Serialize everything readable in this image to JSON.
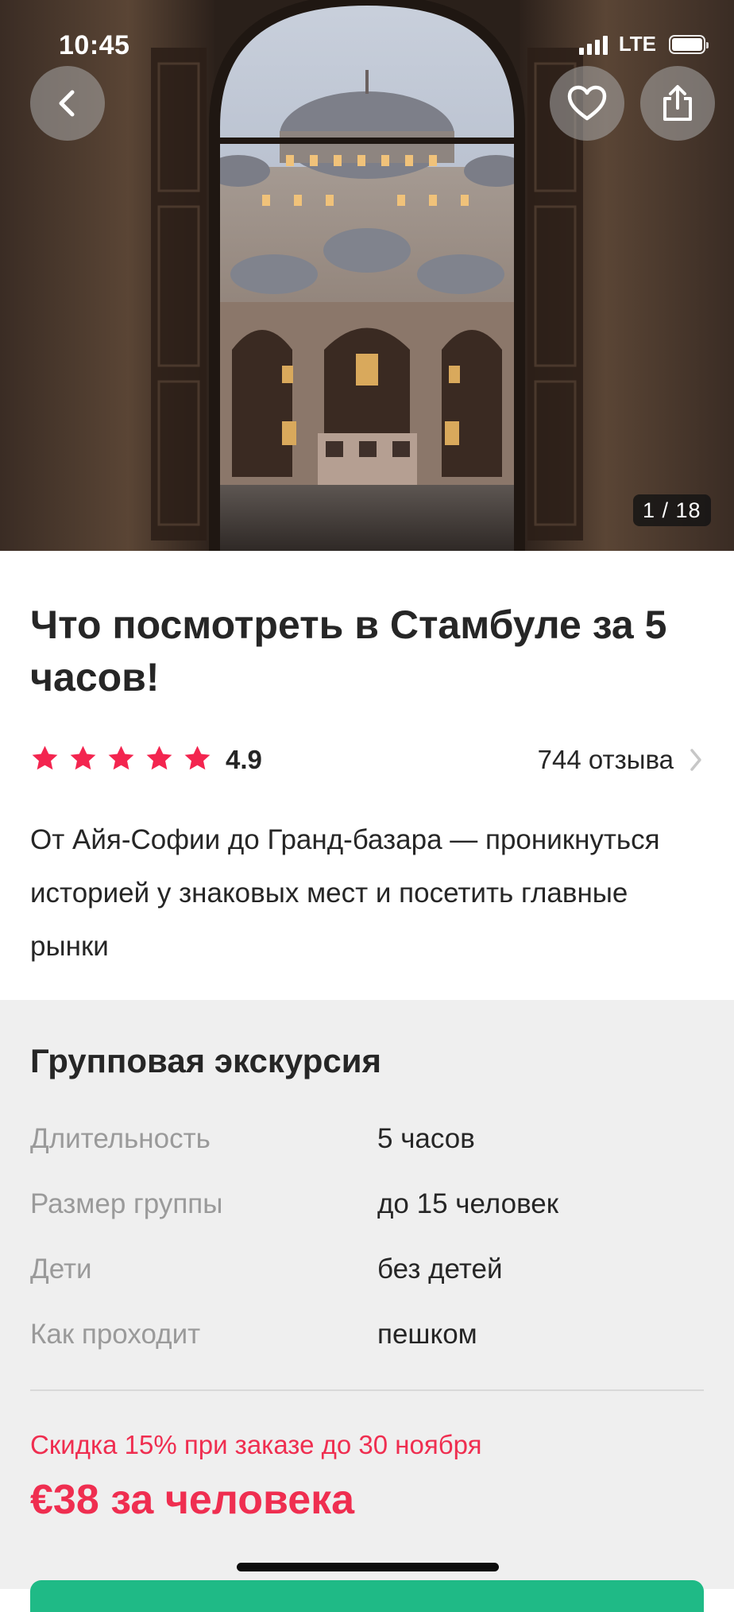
{
  "status_bar": {
    "time": "10:45",
    "network": "LTE"
  },
  "hero": {
    "back_icon": "chevron-left-icon",
    "favorite_icon": "heart-outline-icon",
    "share_icon": "share-icon",
    "photo_counter": "1 / 18"
  },
  "tour": {
    "title": "Что посмотреть в Стамбуле за 5 часов!",
    "rating": "4.9",
    "stars": 5,
    "reviews": "744 отзыва",
    "description": "От Айя-Софии до Гранд-базара — проникнуться историей у знаковых мест и посетить главные рынки"
  },
  "details": {
    "section_title": "Групповая экскурсия",
    "params": [
      {
        "label": "Длительность",
        "value": "5 часов"
      },
      {
        "label": "Размер группы",
        "value": "до 15 человек"
      },
      {
        "label": "Дети",
        "value": "без детей"
      },
      {
        "label": "Как проходит",
        "value": "пешком"
      }
    ],
    "discount": "Скидка 15% при заказе до 30 ноября",
    "price": "€38 за человека"
  },
  "colors": {
    "accent_red": "#ef2e50",
    "star_color": "#f3254f",
    "cta_green": "#1fba86",
    "details_bg": "#efefef"
  }
}
